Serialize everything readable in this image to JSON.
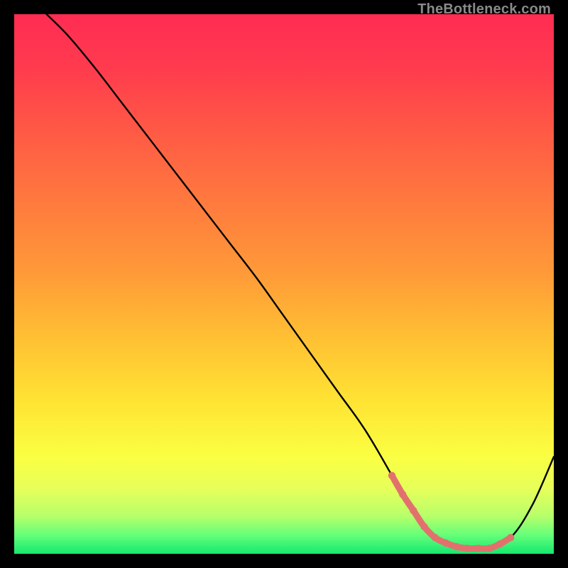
{
  "watermark": "TheBottleneck.com",
  "chart_data": {
    "type": "line",
    "title": "",
    "xlabel": "",
    "ylabel": "",
    "xlim": [
      0,
      100
    ],
    "ylim": [
      0,
      100
    ],
    "grid": false,
    "series": [
      {
        "name": "curve",
        "color": "#000000",
        "x": [
          6,
          10,
          15,
          20,
          25,
          30,
          35,
          40,
          45,
          50,
          55,
          60,
          65,
          70,
          73,
          76,
          80,
          84,
          88,
          92,
          96,
          100
        ],
        "y": [
          100,
          96,
          90,
          83.5,
          77,
          70.5,
          64,
          57.5,
          51,
          44,
          37,
          30,
          23,
          14.5,
          9,
          5,
          2,
          1,
          1,
          3,
          9,
          18
        ]
      },
      {
        "name": "optimal-range",
        "color": "#e2716e",
        "x": [
          70,
          72,
          74,
          76,
          78,
          80,
          82,
          84,
          86,
          88,
          90,
          92
        ],
        "y": [
          14.5,
          11,
          8,
          5,
          3,
          2,
          1.3,
          1,
          1,
          1,
          1.8,
          3
        ]
      }
    ],
    "background_gradient": {
      "stops": [
        {
          "offset": 0.0,
          "color": "#ff2c53"
        },
        {
          "offset": 0.1,
          "color": "#ff3b4e"
        },
        {
          "offset": 0.22,
          "color": "#ff5a45"
        },
        {
          "offset": 0.35,
          "color": "#ff7a3e"
        },
        {
          "offset": 0.48,
          "color": "#ff9a38"
        },
        {
          "offset": 0.6,
          "color": "#ffc033"
        },
        {
          "offset": 0.72,
          "color": "#ffe433"
        },
        {
          "offset": 0.82,
          "color": "#faff42"
        },
        {
          "offset": 0.88,
          "color": "#e6ff5a"
        },
        {
          "offset": 0.93,
          "color": "#b7ff6a"
        },
        {
          "offset": 0.965,
          "color": "#66ff79"
        },
        {
          "offset": 1.0,
          "color": "#14e86f"
        }
      ]
    }
  }
}
